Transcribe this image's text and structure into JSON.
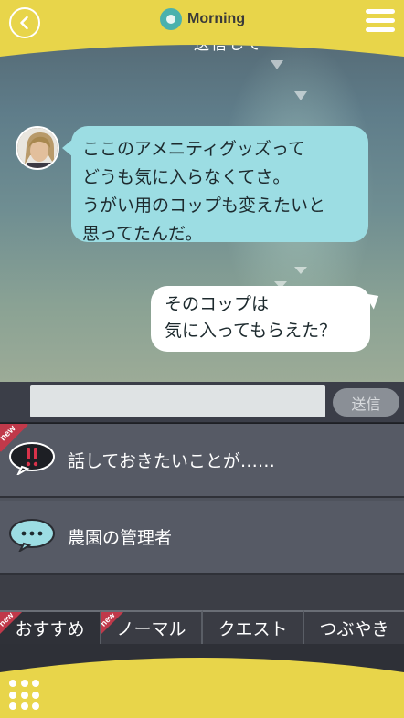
{
  "header": {
    "time_of_day": "Morning"
  },
  "chat": {
    "cut_off_text": "送信して",
    "incoming_message": {
      "lines": [
        "ここのアメニティグッズって",
        "どうも気に入らなくてさ。",
        "うがい用のコップも変えたいと",
        "思ってたんだ。"
      ]
    },
    "outgoing_message": {
      "lines": [
        "そのコップは",
        "気に入ってもらえた？"
      ]
    }
  },
  "input": {
    "value": "",
    "send_label": "送信"
  },
  "choices": [
    {
      "text": "話しておきたいことが……",
      "badge": "new",
      "icon": "exclamation-bubble-icon"
    },
    {
      "text": "農園の管理者",
      "badge": "",
      "icon": "speech-bubble-icon"
    }
  ],
  "tabs": [
    {
      "label": "おすすめ",
      "badge": "new"
    },
    {
      "label": "ノーマル",
      "badge": "new"
    },
    {
      "label": "クエスト",
      "badge": ""
    },
    {
      "label": "つぶやき",
      "badge": ""
    }
  ],
  "colors": {
    "accent_yellow": "#e8d54a",
    "bubble_cyan": "#9cdde3",
    "new_badge_red": "#c0394a"
  }
}
